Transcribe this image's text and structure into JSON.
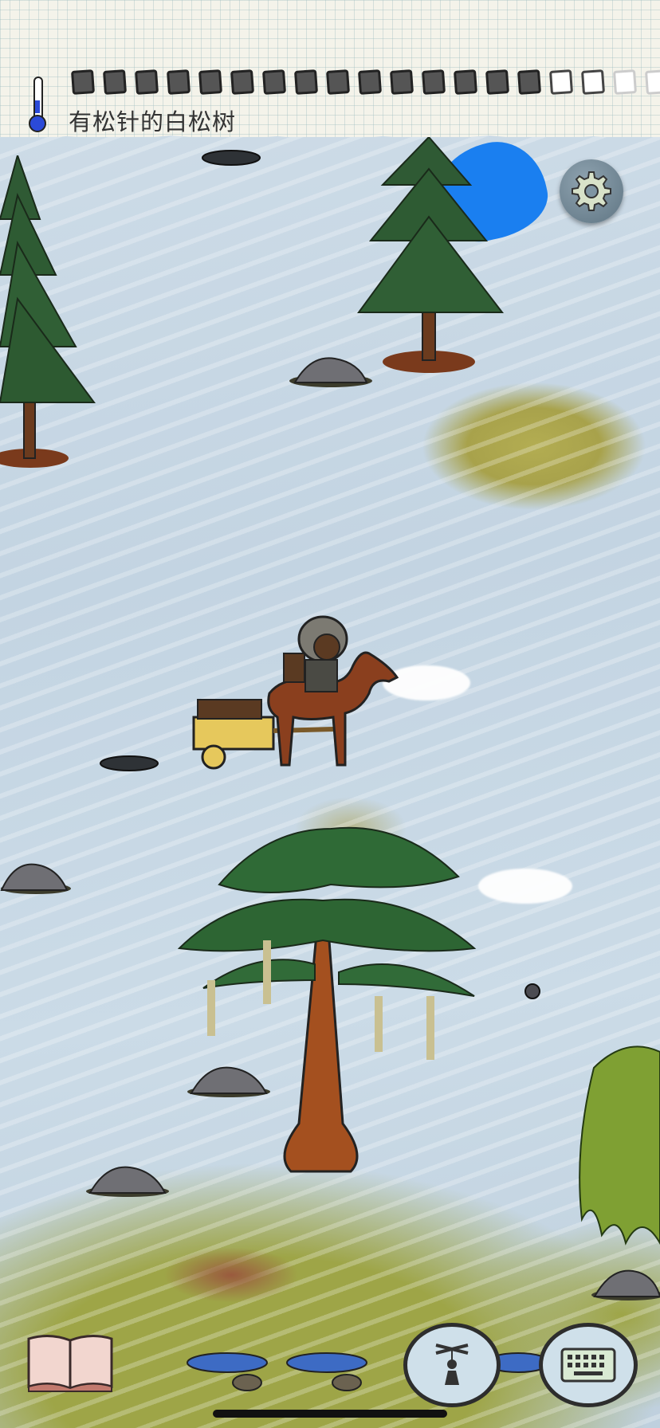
{
  "header": {
    "biome_label": "有松针的白松树",
    "food_pips": [
      "full",
      "full",
      "full",
      "full",
      "full",
      "full",
      "full",
      "full",
      "full",
      "full",
      "full",
      "full",
      "full",
      "full",
      "full",
      "empty",
      "empty",
      "faded",
      "faded",
      "faded"
    ]
  },
  "controls": {
    "settings_icon": "gear-icon",
    "tech_book_icon": "book-icon",
    "emote_icon": "puppet-icon",
    "keyboard_icon": "keyboard-icon"
  },
  "colors": {
    "snow": "#c9d9e6",
    "water": "#1a7ff0",
    "grass": "#9ea547",
    "paper": "#f4f3ea"
  }
}
